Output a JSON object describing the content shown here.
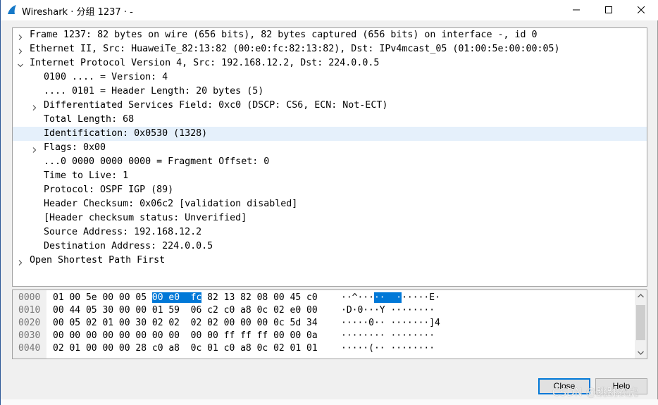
{
  "window": {
    "title": "Wireshark · 分组 1237 · -"
  },
  "tree": {
    "rows": [
      {
        "text": "Frame 1237: 82 bytes on wire (656 bits), 82 bytes captured (656 bits) on interface -, id 0",
        "arrow": "right"
      },
      {
        "text": "Ethernet II, Src: HuaweiTe_82:13:82 (00:e0:fc:82:13:82), Dst: IPv4mcast_05 (01:00:5e:00:00:05)",
        "arrow": "right"
      },
      {
        "text": "Internet Protocol Version 4, Src: 192.168.12.2, Dst: 224.0.0.5",
        "arrow": "down"
      },
      {
        "text": "0100 .... = Version: 4",
        "arrow": ""
      },
      {
        "text": ".... 0101 = Header Length: 20 bytes (5)",
        "arrow": ""
      },
      {
        "text": "Differentiated Services Field: 0xc0 (DSCP: CS6, ECN: Not-ECT)",
        "arrow": "right"
      },
      {
        "text": "Total Length: 68",
        "arrow": ""
      },
      {
        "text": "Identification: 0x0530 (1328)",
        "arrow": ""
      },
      {
        "text": "Flags: 0x00",
        "arrow": "right"
      },
      {
        "text": "...0 0000 0000 0000 = Fragment Offset: 0",
        "arrow": ""
      },
      {
        "text": "Time to Live: 1",
        "arrow": ""
      },
      {
        "text": "Protocol: OSPF IGP (89)",
        "arrow": ""
      },
      {
        "text": "Header Checksum: 0x06c2 [validation disabled]",
        "arrow": ""
      },
      {
        "text": "[Header checksum status: Unverified]",
        "arrow": ""
      },
      {
        "text": "Source Address: 192.168.12.2",
        "arrow": ""
      },
      {
        "text": "Destination Address: 224.0.0.5",
        "arrow": ""
      },
      {
        "text": "Open Shortest Path First",
        "arrow": "right"
      }
    ]
  },
  "hex": {
    "rows": [
      {
        "offset": "0000",
        "pre": "01 00 5e 00 00 05 ",
        "sel": "00 e0  fc",
        "post": " 82 13 82 08 00 45 c0",
        "asc_pre": "··^···",
        "asc_sel": "··  ·",
        "asc_post": "·····E·"
      },
      {
        "offset": "0010",
        "pre": "00 44 05 30 00 00 01 59  06 c2 c0 a8 0c 02 e0 00",
        "sel": "",
        "post": "",
        "asc_pre": "·D·0···Y ········",
        "asc_sel": "",
        "asc_post": ""
      },
      {
        "offset": "0020",
        "pre": "00 05 02 01 00 30 02 02  02 02 00 00 00 0c 5d 34",
        "sel": "",
        "post": "",
        "asc_pre": "·····0·· ·······]4",
        "asc_sel": "",
        "asc_post": ""
      },
      {
        "offset": "0030",
        "pre": "00 00 00 00 00 00 00 00  00 00 ff ff ff 00 00 0a",
        "sel": "",
        "post": "",
        "asc_pre": "········ ········",
        "asc_sel": "",
        "asc_post": ""
      },
      {
        "offset": "0040",
        "pre": "02 01 00 00 00 28 c0 a8  0c 01 c0 a8 0c 02 01 01",
        "sel": "",
        "post": "",
        "asc_pre": "·····(·· ········",
        "asc_sel": "",
        "asc_post": ""
      }
    ]
  },
  "buttons": {
    "close": "Close",
    "help": "Help"
  },
  "watermark": "CSDN @跳跳农虎",
  "colors": {
    "selection": "#0078d7",
    "highlight_row": "#e5f0fb",
    "accent_icon": "#1679c8"
  },
  "icons": {
    "app": "wireshark-fin-icon",
    "minimize": "minimize-icon",
    "maximize": "maximize-icon",
    "close": "close-icon"
  }
}
